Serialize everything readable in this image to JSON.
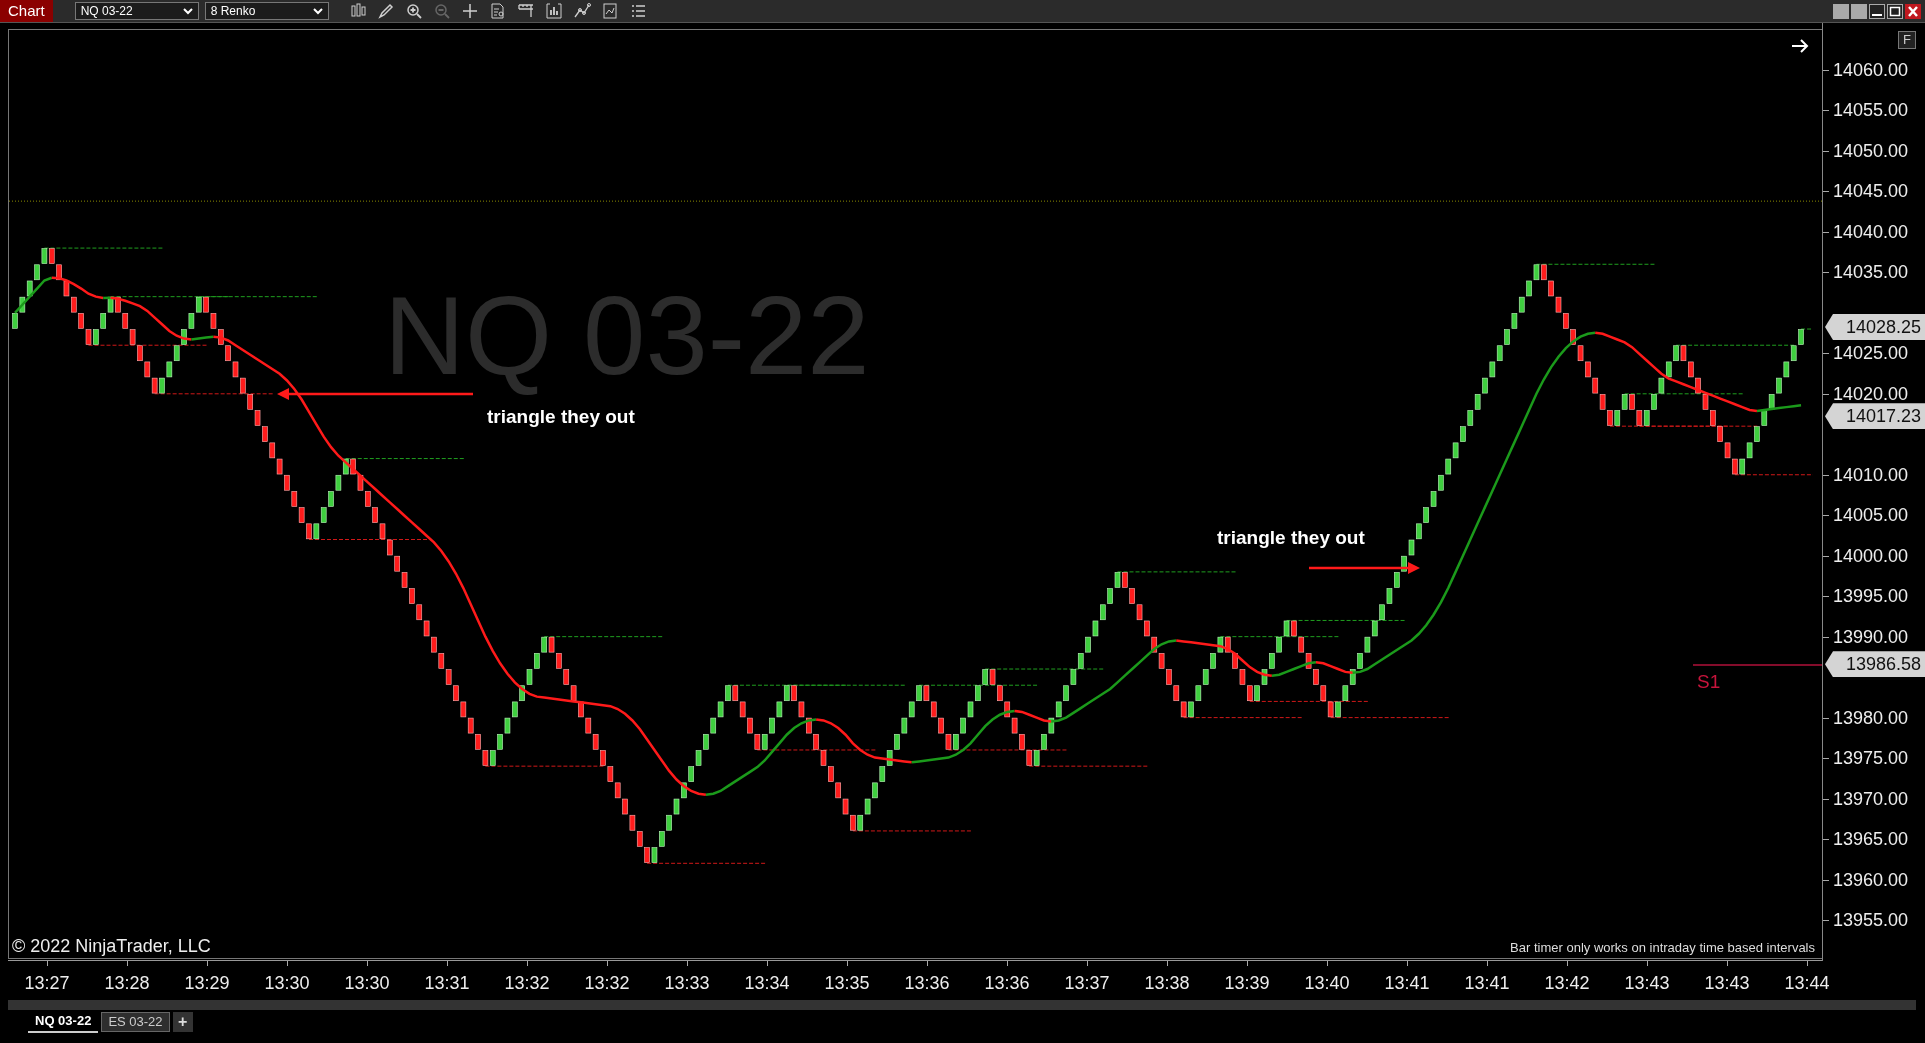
{
  "toolbar": {
    "title": "Chart",
    "instrument": "NQ 03-22",
    "bar_type": "8 Renko",
    "tools": [
      {
        "kind": "bars",
        "disabled": false
      },
      {
        "kind": "pencil",
        "disabled": false
      },
      {
        "kind": "zoom-in",
        "disabled": false
      },
      {
        "kind": "zoom-out",
        "disabled": true
      },
      {
        "kind": "crosshair",
        "disabled": false
      },
      {
        "kind": "data-box",
        "disabled": false
      },
      {
        "kind": "ruler",
        "disabled": false
      },
      {
        "kind": "chart",
        "disabled": false
      },
      {
        "kind": "strategy",
        "disabled": false
      },
      {
        "kind": "properties",
        "disabled": false
      },
      {
        "kind": "list",
        "disabled": false
      }
    ]
  },
  "chart": {
    "watermark": "NQ 03-22",
    "f_button": "F",
    "price_axis": {
      "ticks": [
        "14060.00",
        "14055.00",
        "14050.00",
        "14045.00",
        "14040.00",
        "14035.00",
        "14025.00",
        "14020.00",
        "14010.00",
        "14005.00",
        "14000.00",
        "13995.00",
        "13990.00",
        "13980.00",
        "13975.00",
        "13970.00",
        "13965.00",
        "13960.00",
        "13955.00"
      ]
    },
    "price_markers": [
      {
        "label": "14028.25"
      },
      {
        "label": "14017.23"
      },
      {
        "label": "13986.58"
      }
    ],
    "pivot": {
      "label": "S1"
    },
    "annotations": [
      {
        "text": "triangle they out",
        "kind": "left"
      },
      {
        "text": "triangle they out",
        "kind": "right"
      }
    ],
    "copyright": "© 2022 NinjaTrader, LLC",
    "notice": "Bar timer only works on intraday time based intervals",
    "time_axis": {
      "labels": [
        "13:27",
        "13:28",
        "13:29",
        "13:30",
        "13:30",
        "13:31",
        "13:32",
        "13:32",
        "13:33",
        "13:34",
        "13:35",
        "13:36",
        "13:36",
        "13:37",
        "13:38",
        "13:39",
        "13:40",
        "13:41",
        "13:41",
        "13:42",
        "13:43",
        "13:43",
        "13:44"
      ]
    }
  },
  "tabs": [
    {
      "label": "NQ 03-22",
      "selected": true
    },
    {
      "label": "ES 03-22",
      "selected": false
    }
  ],
  "add_tab": "+"
}
